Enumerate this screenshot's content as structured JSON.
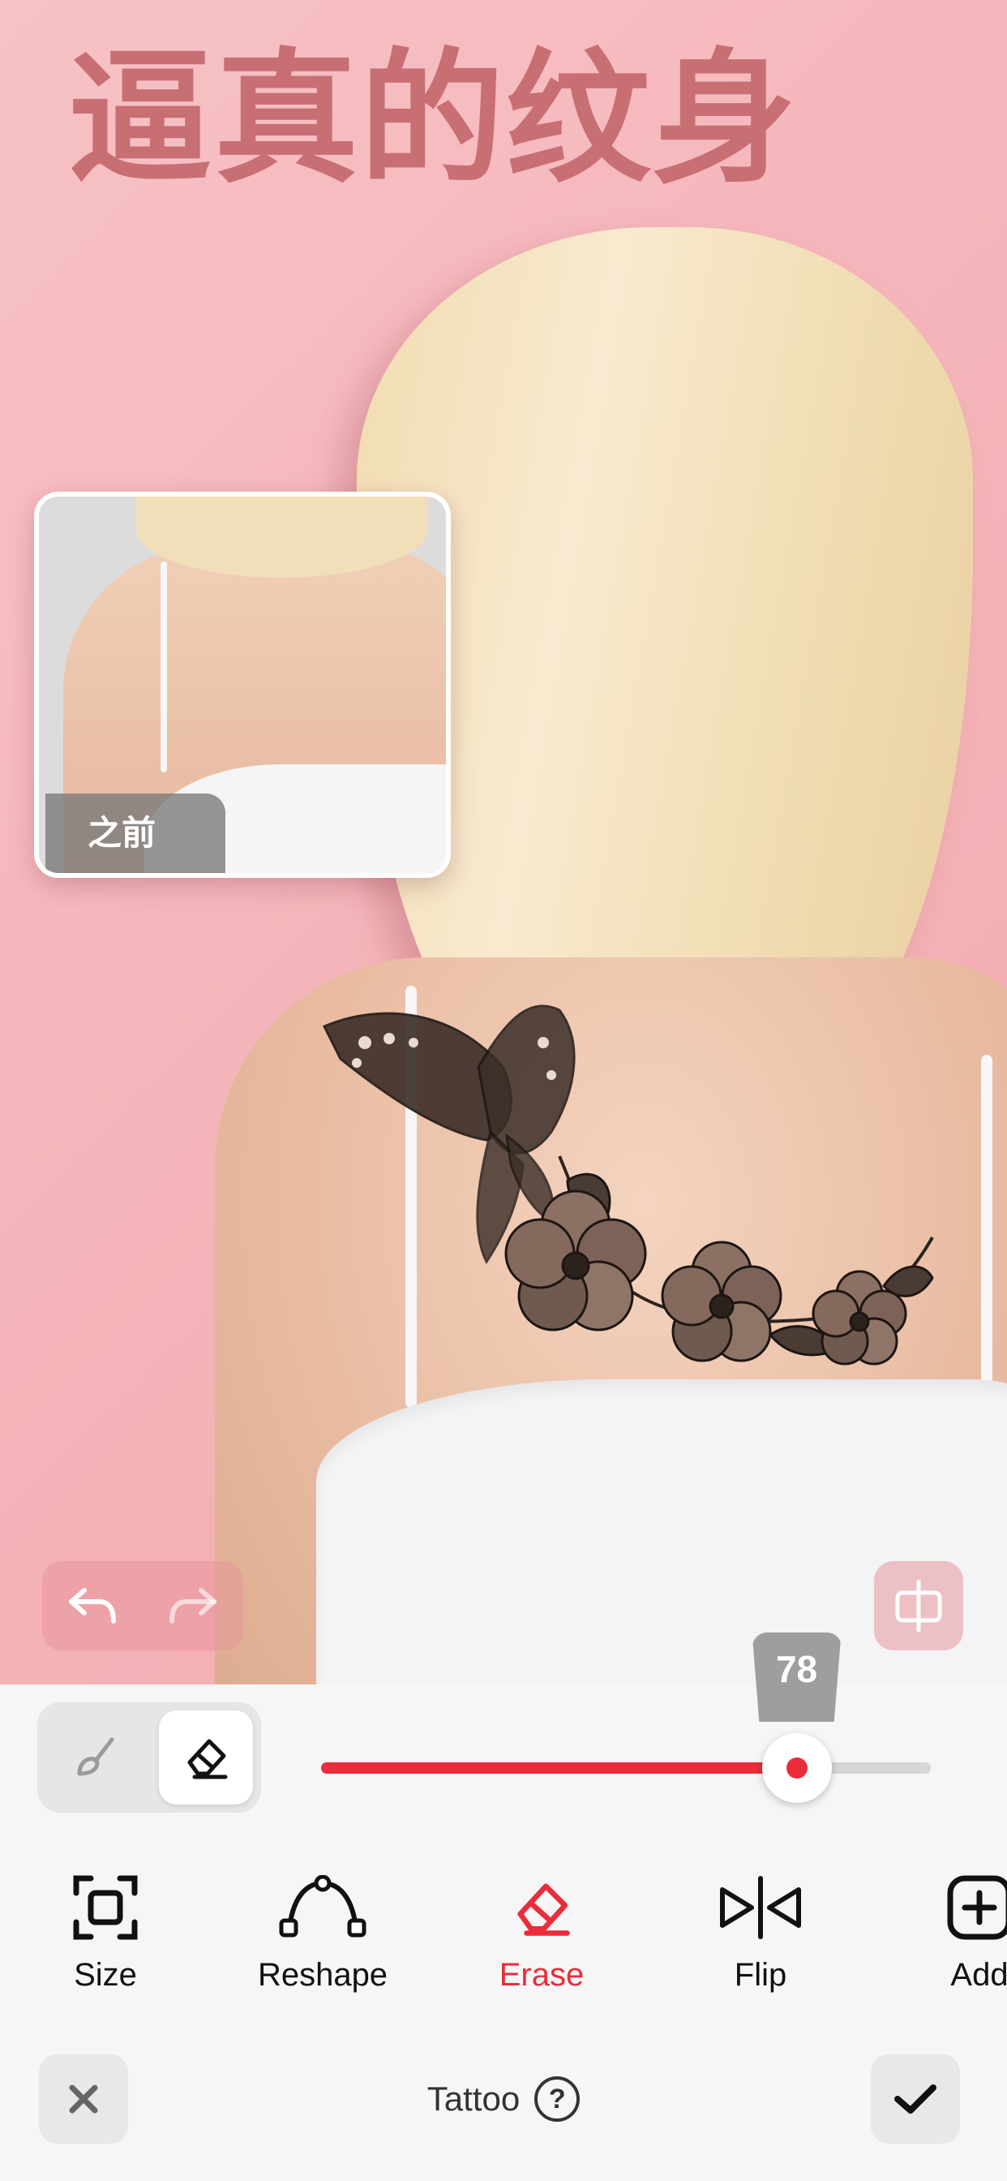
{
  "hero": {
    "title": "逼真的纹身"
  },
  "before_label": "之前",
  "slider": {
    "value": 78,
    "label": "78"
  },
  "tools": [
    {
      "label": "Size",
      "icon": "size-icon"
    },
    {
      "label": "Reshape",
      "icon": "reshape-icon"
    },
    {
      "label": "Erase",
      "icon": "eraser-icon",
      "active": true
    },
    {
      "label": "Flip",
      "icon": "flip-icon"
    },
    {
      "label": "Add",
      "icon": "add-icon"
    }
  ],
  "footer": {
    "title": "Tattoo"
  },
  "colors": {
    "accent": "#ec2b3b",
    "hero_text": "#c86f74",
    "background": "#f6b8bd"
  }
}
